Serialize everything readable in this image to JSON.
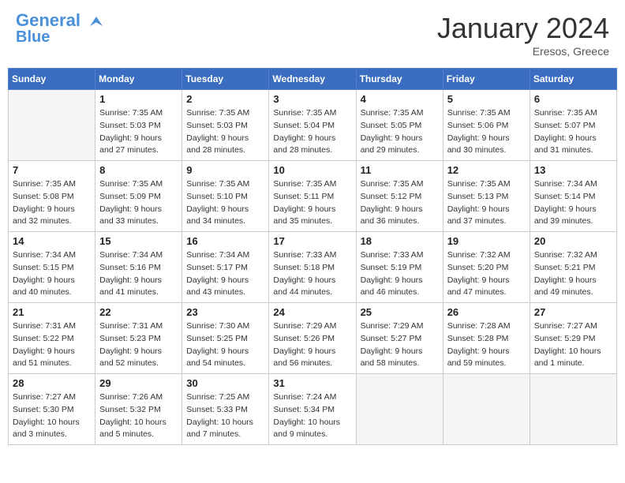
{
  "header": {
    "logo_line1": "General",
    "logo_line2": "Blue",
    "month": "January 2024",
    "location": "Eresos, Greece"
  },
  "weekdays": [
    "Sunday",
    "Monday",
    "Tuesday",
    "Wednesday",
    "Thursday",
    "Friday",
    "Saturday"
  ],
  "weeks": [
    [
      {
        "day": "",
        "info": []
      },
      {
        "day": "1",
        "info": [
          "Sunrise: 7:35 AM",
          "Sunset: 5:03 PM",
          "Daylight: 9 hours",
          "and 27 minutes."
        ]
      },
      {
        "day": "2",
        "info": [
          "Sunrise: 7:35 AM",
          "Sunset: 5:03 PM",
          "Daylight: 9 hours",
          "and 28 minutes."
        ]
      },
      {
        "day": "3",
        "info": [
          "Sunrise: 7:35 AM",
          "Sunset: 5:04 PM",
          "Daylight: 9 hours",
          "and 28 minutes."
        ]
      },
      {
        "day": "4",
        "info": [
          "Sunrise: 7:35 AM",
          "Sunset: 5:05 PM",
          "Daylight: 9 hours",
          "and 29 minutes."
        ]
      },
      {
        "day": "5",
        "info": [
          "Sunrise: 7:35 AM",
          "Sunset: 5:06 PM",
          "Daylight: 9 hours",
          "and 30 minutes."
        ]
      },
      {
        "day": "6",
        "info": [
          "Sunrise: 7:35 AM",
          "Sunset: 5:07 PM",
          "Daylight: 9 hours",
          "and 31 minutes."
        ]
      }
    ],
    [
      {
        "day": "7",
        "info": [
          "Sunrise: 7:35 AM",
          "Sunset: 5:08 PM",
          "Daylight: 9 hours",
          "and 32 minutes."
        ]
      },
      {
        "day": "8",
        "info": [
          "Sunrise: 7:35 AM",
          "Sunset: 5:09 PM",
          "Daylight: 9 hours",
          "and 33 minutes."
        ]
      },
      {
        "day": "9",
        "info": [
          "Sunrise: 7:35 AM",
          "Sunset: 5:10 PM",
          "Daylight: 9 hours",
          "and 34 minutes."
        ]
      },
      {
        "day": "10",
        "info": [
          "Sunrise: 7:35 AM",
          "Sunset: 5:11 PM",
          "Daylight: 9 hours",
          "and 35 minutes."
        ]
      },
      {
        "day": "11",
        "info": [
          "Sunrise: 7:35 AM",
          "Sunset: 5:12 PM",
          "Daylight: 9 hours",
          "and 36 minutes."
        ]
      },
      {
        "day": "12",
        "info": [
          "Sunrise: 7:35 AM",
          "Sunset: 5:13 PM",
          "Daylight: 9 hours",
          "and 37 minutes."
        ]
      },
      {
        "day": "13",
        "info": [
          "Sunrise: 7:34 AM",
          "Sunset: 5:14 PM",
          "Daylight: 9 hours",
          "and 39 minutes."
        ]
      }
    ],
    [
      {
        "day": "14",
        "info": [
          "Sunrise: 7:34 AM",
          "Sunset: 5:15 PM",
          "Daylight: 9 hours",
          "and 40 minutes."
        ]
      },
      {
        "day": "15",
        "info": [
          "Sunrise: 7:34 AM",
          "Sunset: 5:16 PM",
          "Daylight: 9 hours",
          "and 41 minutes."
        ]
      },
      {
        "day": "16",
        "info": [
          "Sunrise: 7:34 AM",
          "Sunset: 5:17 PM",
          "Daylight: 9 hours",
          "and 43 minutes."
        ]
      },
      {
        "day": "17",
        "info": [
          "Sunrise: 7:33 AM",
          "Sunset: 5:18 PM",
          "Daylight: 9 hours",
          "and 44 minutes."
        ]
      },
      {
        "day": "18",
        "info": [
          "Sunrise: 7:33 AM",
          "Sunset: 5:19 PM",
          "Daylight: 9 hours",
          "and 46 minutes."
        ]
      },
      {
        "day": "19",
        "info": [
          "Sunrise: 7:32 AM",
          "Sunset: 5:20 PM",
          "Daylight: 9 hours",
          "and 47 minutes."
        ]
      },
      {
        "day": "20",
        "info": [
          "Sunrise: 7:32 AM",
          "Sunset: 5:21 PM",
          "Daylight: 9 hours",
          "and 49 minutes."
        ]
      }
    ],
    [
      {
        "day": "21",
        "info": [
          "Sunrise: 7:31 AM",
          "Sunset: 5:22 PM",
          "Daylight: 9 hours",
          "and 51 minutes."
        ]
      },
      {
        "day": "22",
        "info": [
          "Sunrise: 7:31 AM",
          "Sunset: 5:23 PM",
          "Daylight: 9 hours",
          "and 52 minutes."
        ]
      },
      {
        "day": "23",
        "info": [
          "Sunrise: 7:30 AM",
          "Sunset: 5:25 PM",
          "Daylight: 9 hours",
          "and 54 minutes."
        ]
      },
      {
        "day": "24",
        "info": [
          "Sunrise: 7:29 AM",
          "Sunset: 5:26 PM",
          "Daylight: 9 hours",
          "and 56 minutes."
        ]
      },
      {
        "day": "25",
        "info": [
          "Sunrise: 7:29 AM",
          "Sunset: 5:27 PM",
          "Daylight: 9 hours",
          "and 58 minutes."
        ]
      },
      {
        "day": "26",
        "info": [
          "Sunrise: 7:28 AM",
          "Sunset: 5:28 PM",
          "Daylight: 9 hours",
          "and 59 minutes."
        ]
      },
      {
        "day": "27",
        "info": [
          "Sunrise: 7:27 AM",
          "Sunset: 5:29 PM",
          "Daylight: 10 hours",
          "and 1 minute."
        ]
      }
    ],
    [
      {
        "day": "28",
        "info": [
          "Sunrise: 7:27 AM",
          "Sunset: 5:30 PM",
          "Daylight: 10 hours",
          "and 3 minutes."
        ]
      },
      {
        "day": "29",
        "info": [
          "Sunrise: 7:26 AM",
          "Sunset: 5:32 PM",
          "Daylight: 10 hours",
          "and 5 minutes."
        ]
      },
      {
        "day": "30",
        "info": [
          "Sunrise: 7:25 AM",
          "Sunset: 5:33 PM",
          "Daylight: 10 hours",
          "and 7 minutes."
        ]
      },
      {
        "day": "31",
        "info": [
          "Sunrise: 7:24 AM",
          "Sunset: 5:34 PM",
          "Daylight: 10 hours",
          "and 9 minutes."
        ]
      },
      {
        "day": "",
        "info": []
      },
      {
        "day": "",
        "info": []
      },
      {
        "day": "",
        "info": []
      }
    ]
  ]
}
